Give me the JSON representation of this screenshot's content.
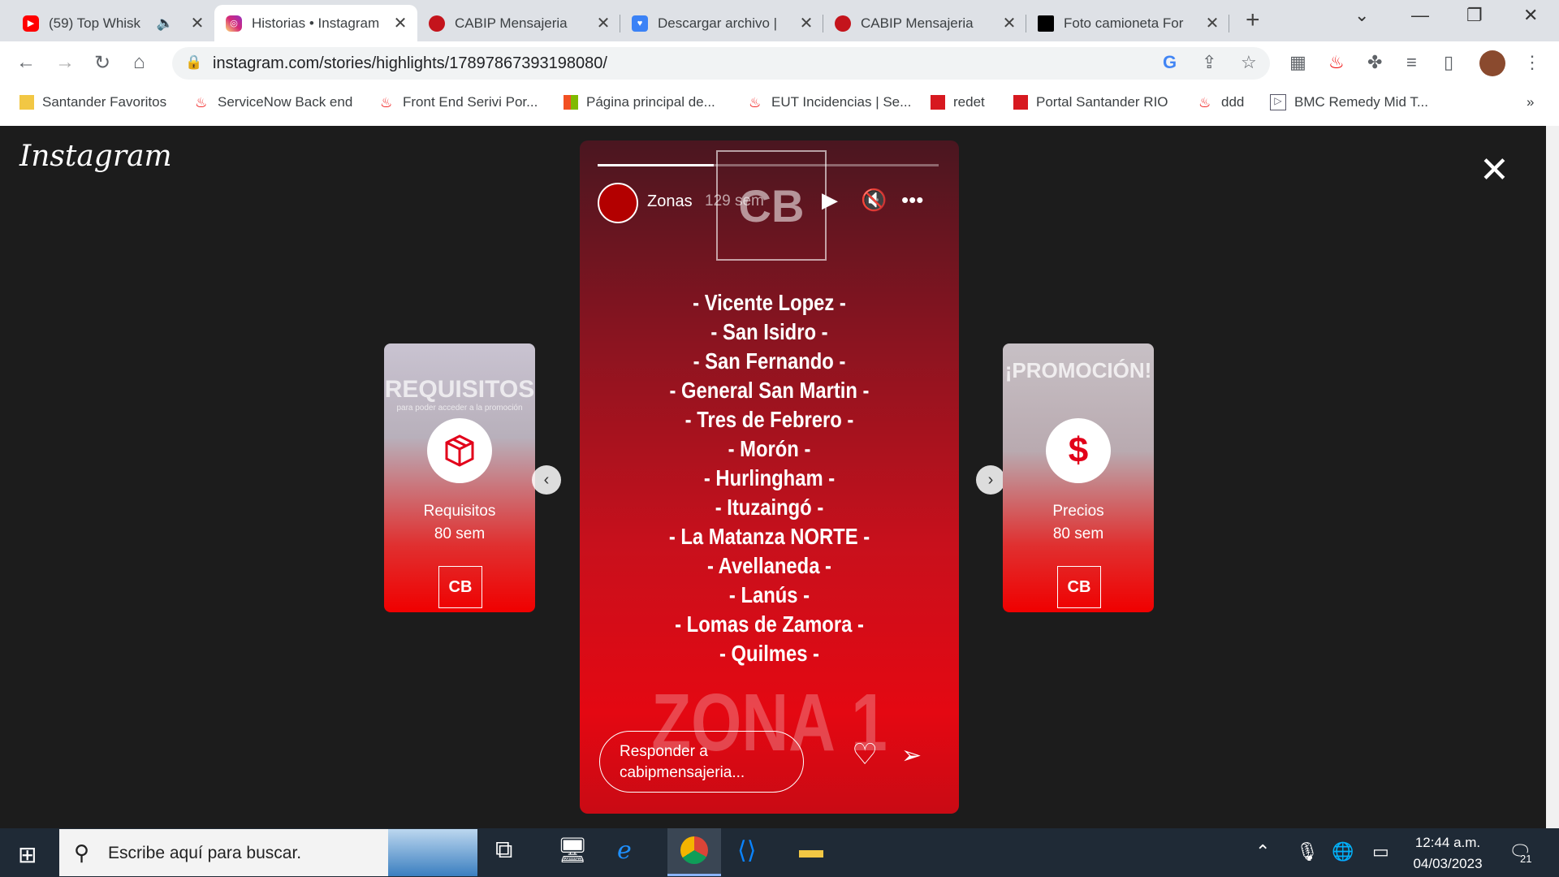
{
  "browser": {
    "tabs": [
      {
        "title": "(59) Top Whisk",
        "icon": "youtube-icon",
        "color": "#ff0000"
      },
      {
        "title": "Historias • Instagram",
        "icon": "instagram-icon",
        "color": "#d6249f"
      },
      {
        "title": "CABIP Mensajeria",
        "icon": "cabip-icon",
        "color": "#c4141c"
      },
      {
        "title": "Descargar archivo |",
        "icon": "heart-download-icon",
        "color": "#3b82f6"
      },
      {
        "title": "CABIP Mensajeria",
        "icon": "cabip-icon",
        "color": "#c4141c"
      },
      {
        "title": "Foto camioneta For",
        "icon": "photo-icon",
        "color": "#000000"
      }
    ],
    "url_host": "instagram.com",
    "url_path": "/stories/highlights/17897867393198080/",
    "bookmarks": [
      "Santander Favoritos",
      "ServiceNow Back end",
      "Front End Serivi Por...",
      "Página principal de...",
      "EUT Incidencias | Se...",
      "redet",
      "Portal Santander RIO",
      "ddd",
      "BMC Remedy Mid T..."
    ]
  },
  "page": {
    "logo": "Instagram",
    "left_story": {
      "name": "Requisitos",
      "time": "80 sem",
      "cb": "CB",
      "title": "REQUISITOS",
      "subtitle": "para poder acceder a la promoción"
    },
    "right_story": {
      "name": "Precios",
      "time": "80 sem",
      "cb": "CB",
      "title": "¡PROMOCIÓN!",
      "price_symbol": "$"
    },
    "main_story": {
      "user": "Zonas",
      "time": "129 sem",
      "progress": 0.34,
      "cb": "CB",
      "zones": [
        "- Vicente Lopez -",
        "- San Isidro -",
        "- San Fernando -",
        "- General San Martin -",
        "- Tres de Febrero -",
        "- Morón -",
        "- Hurlingham -",
        "- Ituzaingó -",
        "- La Matanza NORTE -",
        "- Avellaneda -",
        "- Lanús -",
        "- Lomas de Zamora -",
        "- Quilmes -"
      ],
      "zone_title": "ZONA 1",
      "reply_placeholder": "Responder a cabipmensajeria..."
    }
  },
  "taskbar": {
    "search_placeholder": "Escribe aquí para buscar.",
    "time": "12:44 a.m.",
    "date": "04/03/2023",
    "notifications": "21"
  }
}
